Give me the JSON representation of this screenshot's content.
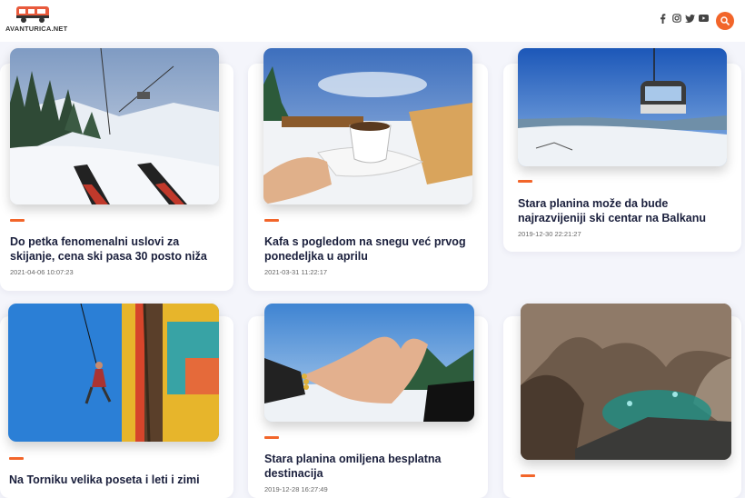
{
  "header": {
    "logo_text": "AVANTURICA.NET",
    "social_icons": [
      "facebook-icon",
      "instagram-icon",
      "twitter-icon",
      "youtube-icon"
    ],
    "search_icon": "search-icon"
  },
  "colors": {
    "accent": "#f2652a",
    "title": "#1a1f3c"
  },
  "articles": [
    {
      "title": "Do petka fenomenalni uslovi za skijanje, cena ski pasa 30 posto niža",
      "date": "2021-04-06 10:07:23"
    },
    {
      "title": "Kafa s pogledom na snegu već prvog ponedeljka u aprilu",
      "date": "2021-03-31 11:22:17"
    },
    {
      "title": "Stara planina može da bude najrazvijeniji ski centar na Balkanu",
      "date": "2019-12-30 22:21:27"
    },
    {
      "title": "Na Torniku velika poseta i leti i zimi",
      "date": ""
    },
    {
      "title": "Stara planina omiljena besplatna destinacija",
      "date": "2019-12-28 16:27:49"
    },
    {
      "title": "",
      "date": ""
    }
  ]
}
